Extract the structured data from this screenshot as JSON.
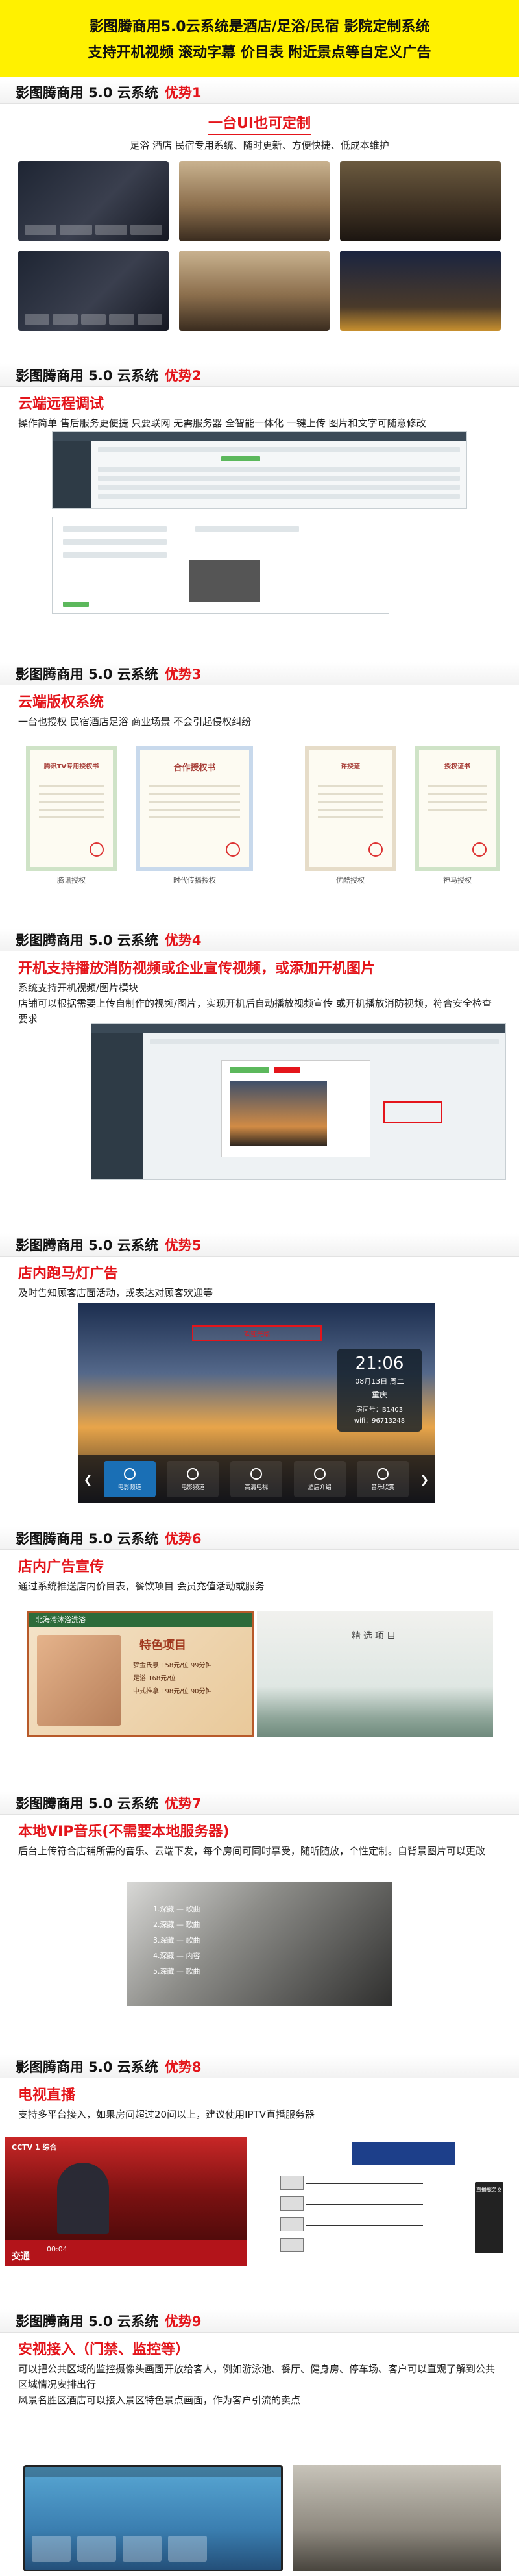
{
  "header": {
    "line1": "影图腾商用5.0云系统是酒店/足浴/民宿 影院定制系统",
    "line2": "支持开机视频 滚动字幕 价目表 附近景点等自定义广告"
  },
  "sections": [
    {
      "title": "影图腾商用 5.0 云系统",
      "advantage": "优势1",
      "subtitle": "一台UI也可定制",
      "desc": "足浴 酒店 民宿专用系统、随时更新、方便快捷、低成本维护"
    },
    {
      "title": "影图腾商用 5.0 云系统",
      "advantage": "优势2",
      "subtitle": "云端远程调试",
      "desc": "操作简单 售后服务更便捷 只要联网 无需服务器 全智能一体化 一键上传 图片和文字可随意修改"
    },
    {
      "title": "影图腾商用 5.0 云系统",
      "advantage": "优势3",
      "subtitle": "云端版权系统",
      "desc": "一台也授权 民宿酒店足浴 商业场景 不会引起侵权纠纷",
      "certs": [
        {
          "title": "腾讯TV专用授权书",
          "caption": "腾讯授权"
        },
        {
          "title": "合作授权书",
          "caption": "时代传播授权"
        },
        {
          "title": "许授证",
          "caption": "优酷授权"
        },
        {
          "title": "授权证书",
          "caption": "神马授权"
        }
      ]
    },
    {
      "title": "影图腾商用 5.0 云系统",
      "advantage": "优势4",
      "subtitle": "开机支持播放消防视频或企业宣传视频，或添加开机图片",
      "desc": "系统支持开机视频/图片模块\n店铺可以根据需要上传自制作的视频/图片，实现开机后自动播放视频宣传 或开机播放消防视频，符合安全检查要求"
    },
    {
      "title": "影图腾商用 5.0 云系统",
      "advantage": "优势5",
      "subtitle": "店内跑马灯广告",
      "desc": "及时告知顾客店面活动，或表达对顾客欢迎等",
      "tv": {
        "badge": "欢迎光临",
        "time": "21:06",
        "date": "08月13日 周二",
        "city": "重庆",
        "room": "房间号：B1403",
        "wifi": "wifi：96713248",
        "dock": [
          "电影频道",
          "电影频道",
          "高清电视",
          "酒店介绍",
          "音乐欣赏"
        ]
      }
    },
    {
      "title": "影图腾商用 5.0 云系统",
      "advantage": "优势6",
      "subtitle": "店内广告宣传",
      "desc": "通过系统推送店内价目表，餐饮项目 会员充值活动或服务",
      "promo": {
        "board_head": "北海湾沐浴洗浴",
        "board_title": "特色项目",
        "board_items": [
          "梦金氏泉 158元/位 99分钟",
          "足浴 168元/位",
          "中式推拿 198元/位 90分钟"
        ],
        "scenic_title": "精选项目"
      }
    },
    {
      "title": "影图腾商用 5.0 云系统",
      "advantage": "优势7",
      "subtitle": "本地VIP音乐(不需要本地服务器)",
      "desc": "后台上传符合店铺所需的音乐、云端下发，每个房间可同时享受，随听随放，个性定制。自背景图片可以更改",
      "tracks": [
        "1.深藏 — 歌曲",
        "2.深藏 — 歌曲",
        "3.深藏 — 歌曲",
        "4.深藏 — 内容",
        "5.深藏 — 歌曲"
      ]
    },
    {
      "title": "影图腾商用 5.0 云系统",
      "advantage": "优势8",
      "subtitle": "电视直播",
      "desc": "支持多平台接入，如果房间超过20间以上，建议使用IPTV直播服务器",
      "cctv_logo": "CCTV 1 综合",
      "cctv_time": "00:04",
      "cctv_name": "交通",
      "server_label": "直播服务器"
    },
    {
      "title": "影图腾商用 5.0 云系统",
      "advantage": "优势9",
      "subtitle": "安视接入（门禁、监控等）",
      "desc": "可以把公共区域的监控摄像头画面开放给客人，例如游泳池、餐厅、健身房、停车场、客户可以直观了解到公共区域情况安排出行\n风景名胜区酒店可以接入景区特色景点画面，作为客户引流的卖点"
    }
  ]
}
